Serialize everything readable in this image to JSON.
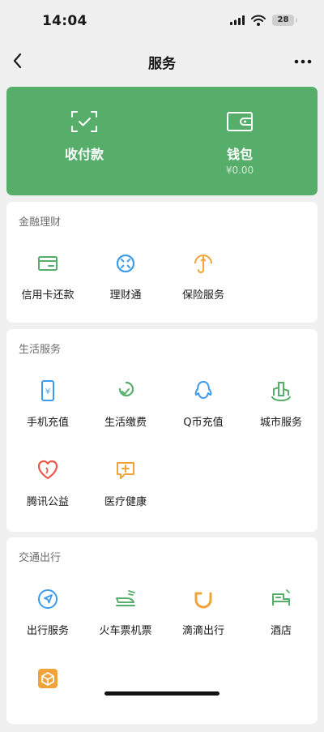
{
  "status": {
    "time": "14:04",
    "battery": "28"
  },
  "nav": {
    "title": "服务"
  },
  "wallet": {
    "pay_label": "收付款",
    "wallet_label": "钱包",
    "balance": "¥0.00"
  },
  "finance": {
    "title": "金融理财",
    "items": [
      {
        "label": "信用卡还款",
        "icon": "credit-card-icon"
      },
      {
        "label": "理财通",
        "icon": "wealth-icon"
      },
      {
        "label": "保险服务",
        "icon": "insurance-icon"
      }
    ]
  },
  "life": {
    "title": "生活服务",
    "items": [
      {
        "label": "手机充值",
        "icon": "phone-recharge-icon"
      },
      {
        "label": "生活缴费",
        "icon": "utility-payment-icon"
      },
      {
        "label": "Q币充值",
        "icon": "qq-coin-icon"
      },
      {
        "label": "城市服务",
        "icon": "city-service-icon"
      },
      {
        "label": "腾讯公益",
        "icon": "charity-icon"
      },
      {
        "label": "医疗健康",
        "icon": "medical-icon"
      }
    ]
  },
  "travel": {
    "title": "交通出行",
    "items": [
      {
        "label": "出行服务",
        "icon": "navigation-icon"
      },
      {
        "label": "火车票机票",
        "icon": "train-plane-icon"
      },
      {
        "label": "滴滴出行",
        "icon": "didi-icon"
      },
      {
        "label": "酒店",
        "icon": "hotel-icon"
      },
      {
        "label": "",
        "icon": "package-icon"
      }
    ]
  },
  "colors": {
    "green": "#57ad6a",
    "blue": "#3d9be9",
    "orange": "#f0a339",
    "red": "#e8594e"
  }
}
